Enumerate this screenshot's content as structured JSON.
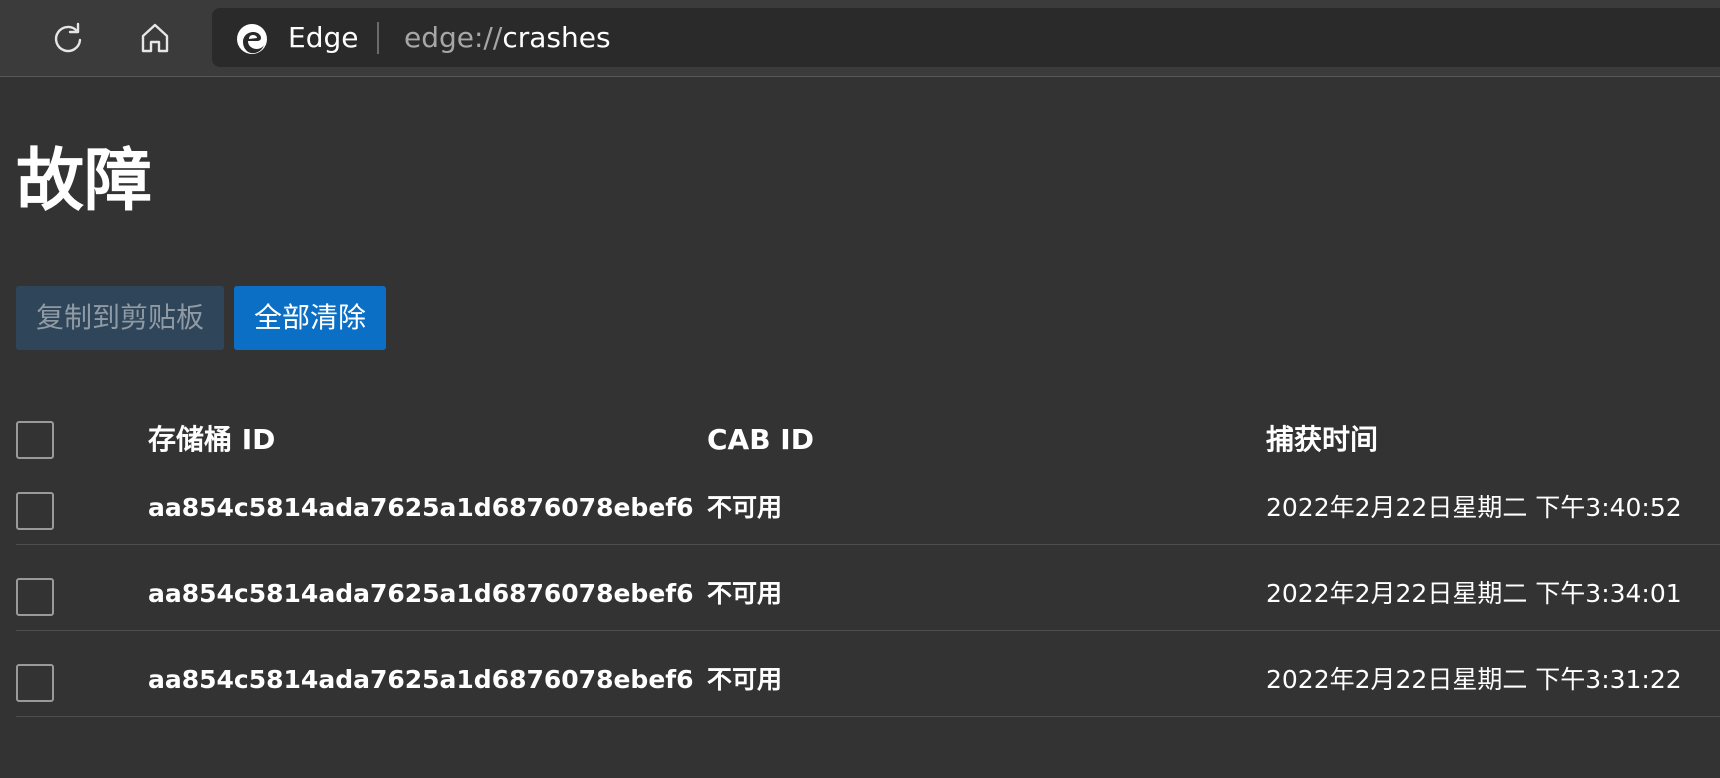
{
  "browser": {
    "site_name": "Edge",
    "url_scheme": "edge://",
    "url_path": "crashes"
  },
  "page": {
    "title": "故障"
  },
  "actions": {
    "copy_label": "复制到剪贴板",
    "clear_label": "全部清除"
  },
  "table": {
    "headers": [
      "存储桶 ID",
      "CAB ID",
      "捕获时间"
    ],
    "rows": [
      {
        "bucket_id": "aa854c5814ada7625a1d6876078ebef6",
        "cab_id": "不可用",
        "time": "2022年2月22日星期二 下午3:40:52"
      },
      {
        "bucket_id": "aa854c5814ada7625a1d6876078ebef6",
        "cab_id": "不可用",
        "time": "2022年2月22日星期二 下午3:34:01"
      },
      {
        "bucket_id": "aa854c5814ada7625a1d6876078ebef6",
        "cab_id": "不可用",
        "time": "2022年2月22日星期二 下午3:31:22"
      }
    ]
  },
  "icons": {
    "refresh": "refresh-icon",
    "home": "home-icon",
    "edge": "edge-logo-icon"
  },
  "colors": {
    "background": "#333333",
    "accent": "#0b6fc5"
  }
}
